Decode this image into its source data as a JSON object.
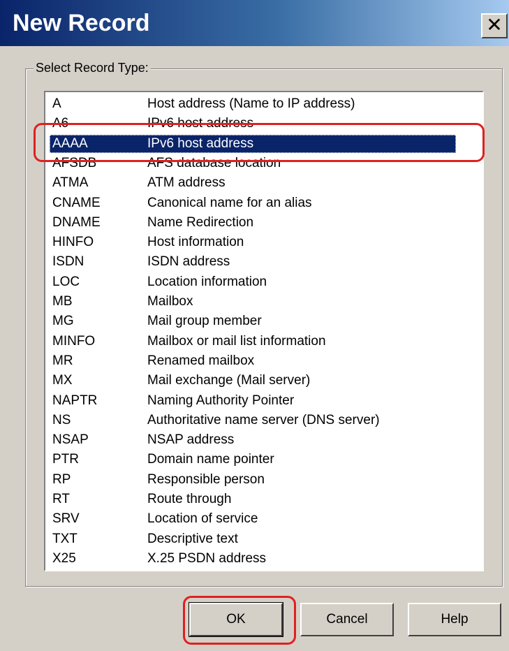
{
  "window": {
    "title": "New Record",
    "close_glyph": "✕"
  },
  "group": {
    "label": "Select Record Type:"
  },
  "list": {
    "selected_index": 2,
    "items": [
      {
        "code": "A",
        "desc": "Host address (Name to IP address)"
      },
      {
        "code": "A6",
        "desc": "IPv6 host address"
      },
      {
        "code": "AAAA",
        "desc": "IPv6 host address"
      },
      {
        "code": "AFSDB",
        "desc": "AFS database location"
      },
      {
        "code": "ATMA",
        "desc": "ATM address"
      },
      {
        "code": "CNAME",
        "desc": "Canonical name for an alias"
      },
      {
        "code": "DNAME",
        "desc": "Name Redirection"
      },
      {
        "code": "HINFO",
        "desc": "Host information"
      },
      {
        "code": "ISDN",
        "desc": "ISDN address"
      },
      {
        "code": "LOC",
        "desc": "Location information"
      },
      {
        "code": "MB",
        "desc": "Mailbox"
      },
      {
        "code": "MG",
        "desc": "Mail group member"
      },
      {
        "code": "MINFO",
        "desc": "Mailbox or mail list information"
      },
      {
        "code": "MR",
        "desc": "Renamed mailbox"
      },
      {
        "code": "MX",
        "desc": "Mail exchange (Mail server)"
      },
      {
        "code": "NAPTR",
        "desc": "Naming Authority Pointer"
      },
      {
        "code": "NS",
        "desc": "Authoritative name server (DNS server)"
      },
      {
        "code": "NSAP",
        "desc": "NSAP address"
      },
      {
        "code": "PTR",
        "desc": "Domain name pointer"
      },
      {
        "code": "RP",
        "desc": "Responsible person"
      },
      {
        "code": "RT",
        "desc": "Route through"
      },
      {
        "code": "SRV",
        "desc": "Location of service"
      },
      {
        "code": "TXT",
        "desc": "Descriptive text"
      },
      {
        "code": "X25",
        "desc": "X.25 PSDN address"
      }
    ]
  },
  "buttons": {
    "ok": "OK",
    "cancel": "Cancel",
    "help": "Help"
  },
  "colors": {
    "highlight_annotation": "#e02020",
    "selection": "#0a246a",
    "title_bar": "#0a246a"
  }
}
